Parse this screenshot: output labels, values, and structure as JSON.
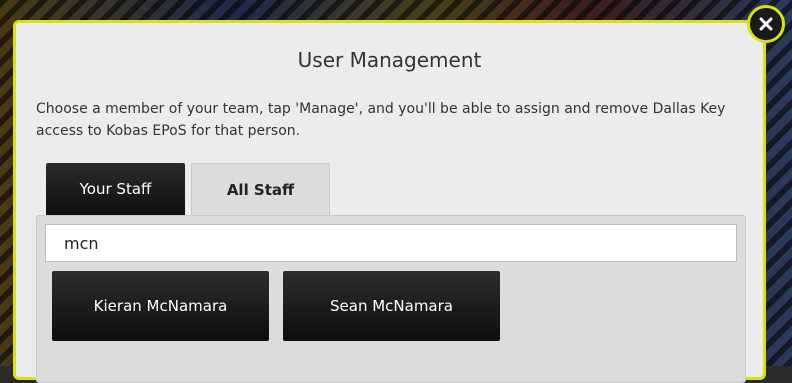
{
  "modal": {
    "title": "User Management",
    "intro": "Choose a member of your team, tap 'Manage', and you'll be able to assign and remove Dallas Key access to Kobas EPoS for that person.",
    "close_icon": "close-icon",
    "accent_color": "#d7e01a"
  },
  "tabs": [
    {
      "label": "Your Staff",
      "active": false
    },
    {
      "label": "All Staff",
      "active": true
    }
  ],
  "search": {
    "value": "mcn"
  },
  "results": [
    {
      "name": "Kieran McNamara"
    },
    {
      "name": "Sean McNamara"
    }
  ]
}
